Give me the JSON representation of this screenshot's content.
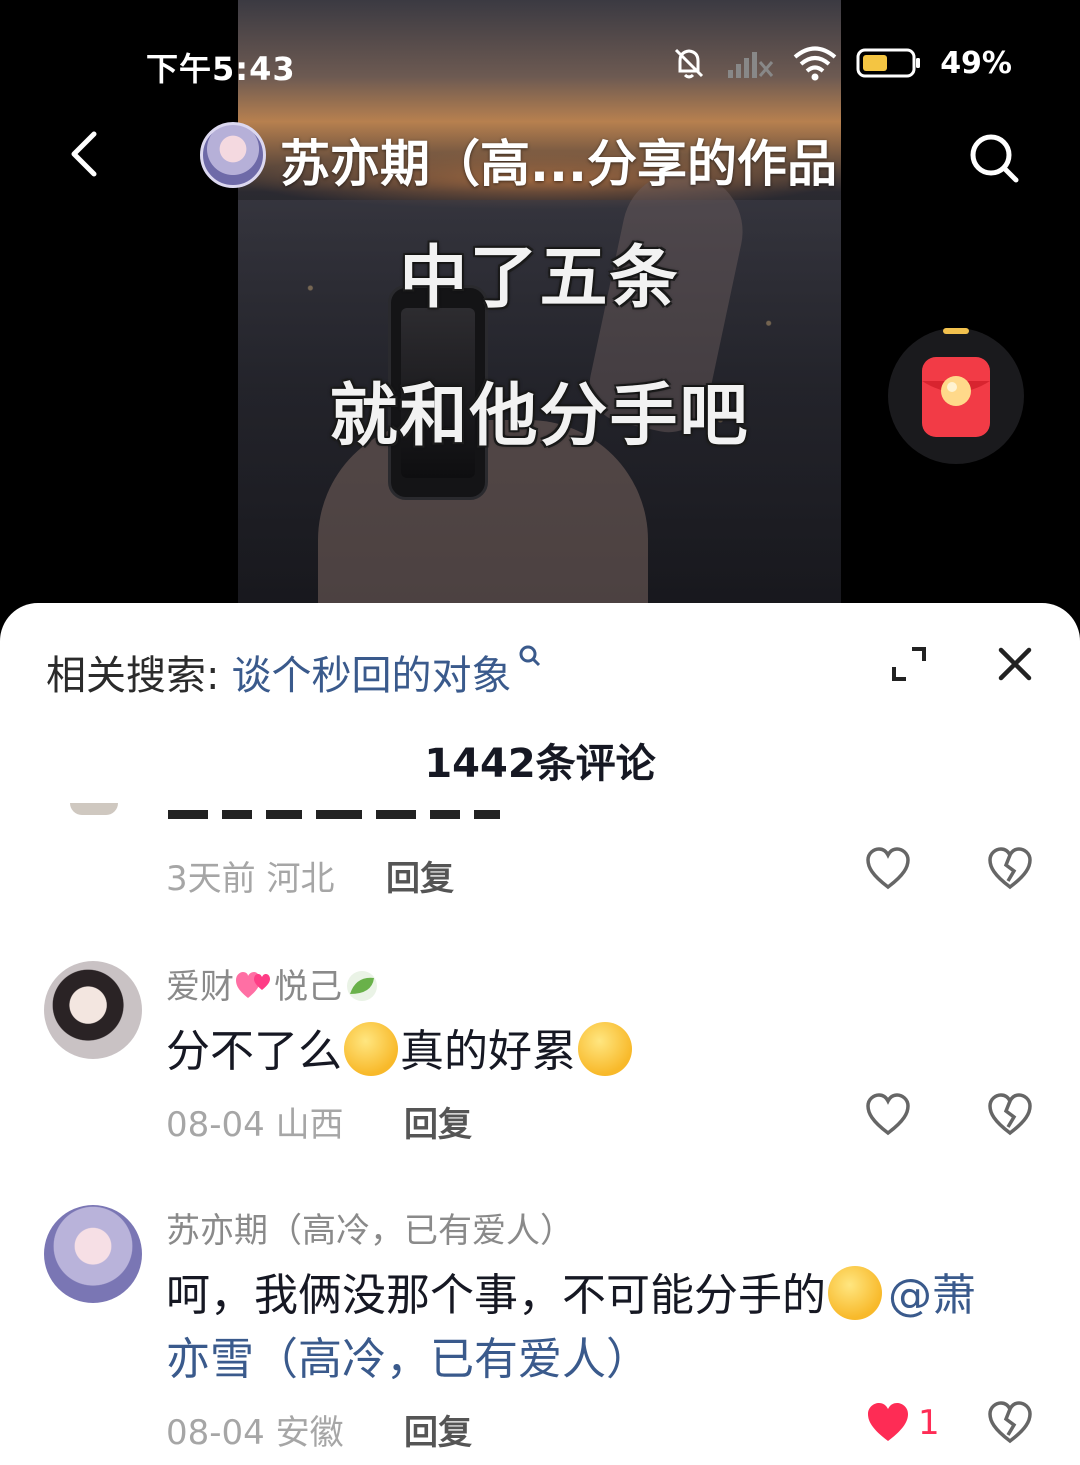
{
  "status_bar": {
    "time": "下午5:43",
    "battery": "49%"
  },
  "nav": {
    "title": "苏亦期（高...分享的作品"
  },
  "video": {
    "caption_line1": "中了五条",
    "caption_line2": "就和他分手吧"
  },
  "sheet": {
    "related_label": "相关搜索:",
    "related_query": "谈个秒回的对象",
    "comment_count": "1442条评论",
    "reply_label": "回复"
  },
  "comments": [
    {
      "meta": "3天前 河北"
    },
    {
      "username_part1": "爱财",
      "username_part2": "悦己",
      "text_part1": "分不了么",
      "text_part2": "真的好累",
      "meta": "08-04 山西"
    },
    {
      "username": "苏亦期（高冷，已有爱人）",
      "text_part1": "呵，我俩没那个事，不可能分手的",
      "mention_line1": "@萧",
      "mention_line2": "亦雪（高冷，已有爱人）",
      "meta": "08-04 安徽",
      "likes": "1"
    }
  ],
  "colors": {
    "accent_link": "#3a5a8c",
    "like_red": "#fe2c55",
    "redpack": "#f23b46"
  }
}
